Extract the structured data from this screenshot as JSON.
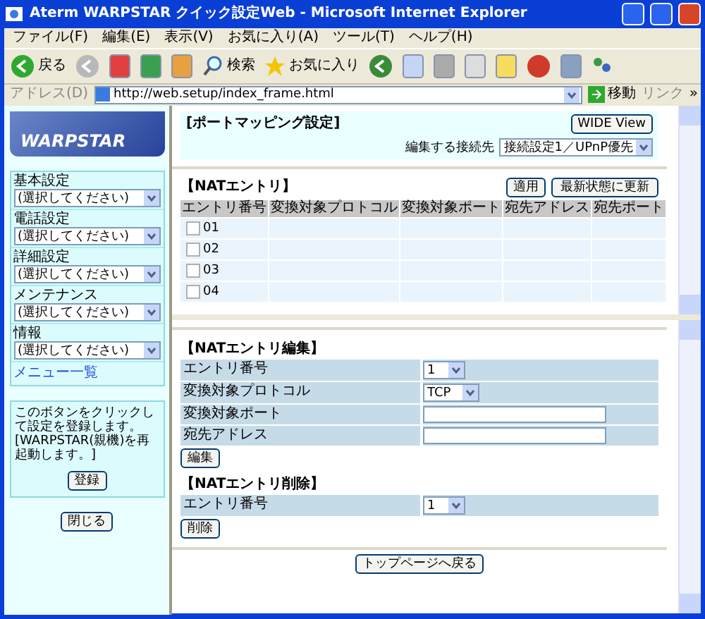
{
  "window": {
    "title": "Aterm WARPSTAR クイック設定Web - Microsoft Internet Explorer"
  },
  "menu": [
    "ファイル(F)",
    "編集(E)",
    "表示(V)",
    "お気に入り(A)",
    "ツール(T)",
    "ヘルプ(H)"
  ],
  "toolbar": {
    "back": "戻る",
    "search": "検索",
    "favorites": "お気に入り"
  },
  "address": {
    "label": "アドレス(D)",
    "url": "http://web.setup/index_frame.html",
    "go": "移動",
    "links": "リンク",
    "more": "»"
  },
  "sidebar": {
    "logo": "WARPSTAR",
    "groups": [
      {
        "label": "基本設定",
        "value": "(選択してください)"
      },
      {
        "label": "電話設定",
        "value": "(選択してください)"
      },
      {
        "label": "詳細設定",
        "value": "(選択してください)"
      },
      {
        "label": "メンテナンス",
        "value": "(選択してください)"
      },
      {
        "label": "情報",
        "value": "(選択してください)"
      }
    ],
    "menu_link": "メニュー一覧",
    "note": "このボタンをクリックして設定を登録します。[WARPSTAR(親機)を再起動します。]",
    "register": "登録",
    "close": "閉じる"
  },
  "top": {
    "title": "[ポートマッピング設定]",
    "wide": "WIDE View",
    "connection_label": "編集する接続先",
    "connection": "接続設定1／UPnP優先",
    "nat_title": "【NATエントリ】",
    "apply": "適用",
    "refresh": "最新状態に更新",
    "columns": [
      "エントリ番号",
      "変換対象プロトコル",
      "変換対象ポート",
      "宛先アドレス",
      "宛先ポート"
    ],
    "rows": [
      {
        "number": "01",
        "checked": false
      },
      {
        "number": "02",
        "checked": false
      },
      {
        "number": "03",
        "checked": false
      },
      {
        "number": "04",
        "checked": false
      }
    ]
  },
  "bottom": {
    "edit_title": "【NATエントリ編集】",
    "edit_fields": [
      {
        "label": "エントリ番号",
        "kind": "select",
        "value": "1"
      },
      {
        "label": "変換対象プロトコル",
        "kind": "select",
        "value": "TCP"
      },
      {
        "label": "変換対象ポート",
        "kind": "input"
      },
      {
        "label": "宛先アドレス",
        "kind": "input"
      }
    ],
    "edit_button": "編集",
    "delete_title": "【NATエントリ削除】",
    "delete_fields": [
      {
        "label": "エントリ番号",
        "kind": "select",
        "value": "1"
      }
    ],
    "delete_button": "削除",
    "back": "トップページへ戻る"
  }
}
